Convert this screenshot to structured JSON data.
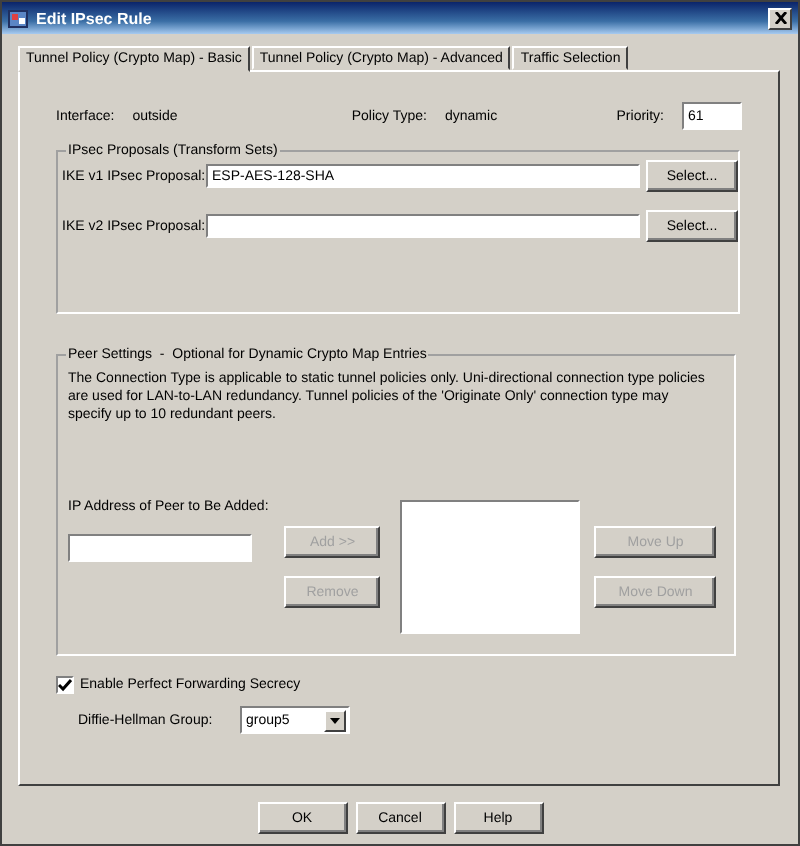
{
  "window": {
    "title": "Edit IPsec Rule"
  },
  "tabs": [
    {
      "label": "Tunnel Policy (Crypto Map) - Basic",
      "selected": true
    },
    {
      "label": "Tunnel Policy (Crypto Map) - Advanced",
      "selected": false
    },
    {
      "label": "Traffic Selection",
      "selected": false
    }
  ],
  "interface": {
    "label": "Interface:",
    "value": "outside"
  },
  "policy_type": {
    "label": "Policy Type:",
    "value": "dynamic"
  },
  "priority": {
    "label": "Priority:",
    "value": "61"
  },
  "proposals": {
    "title": "IPsec Proposals (Transform Sets)",
    "rows": [
      {
        "label": "IKE v1 IPsec Proposal:",
        "value": "ESP-AES-128-SHA",
        "button": "Select..."
      },
      {
        "label": "IKE v2 IPsec Proposal:",
        "button": "Select..."
      }
    ]
  },
  "peer_settings": {
    "title": "Peer Settings  -  Optional for Dynamic Crypto Map Entries",
    "description": "The Connection Type is applicable to static tunnel policies only. Uni-directional connection type policies are used for LAN-to-LAN redundancy. Tunnel policies of the 'Originate Only' connection type may specify up to 10 redundant peers.",
    "ip_label": "IP Address of Peer to Be Added:",
    "buttons": [
      {
        "label": "Add >>",
        "disabled": true
      },
      {
        "label": "Move Up",
        "disabled": true
      },
      {
        "label": "Remove",
        "disabled": true
      },
      {
        "label": "Move Down",
        "disabled": true
      }
    ]
  },
  "pfs": {
    "label": "Enable Perfect Forwarding Secrecy",
    "checked": true
  },
  "dh_group": {
    "label": "Diffie-Hellman Group:",
    "value": "group5"
  },
  "buttons": [
    "OK",
    "Cancel",
    "Help"
  ]
}
